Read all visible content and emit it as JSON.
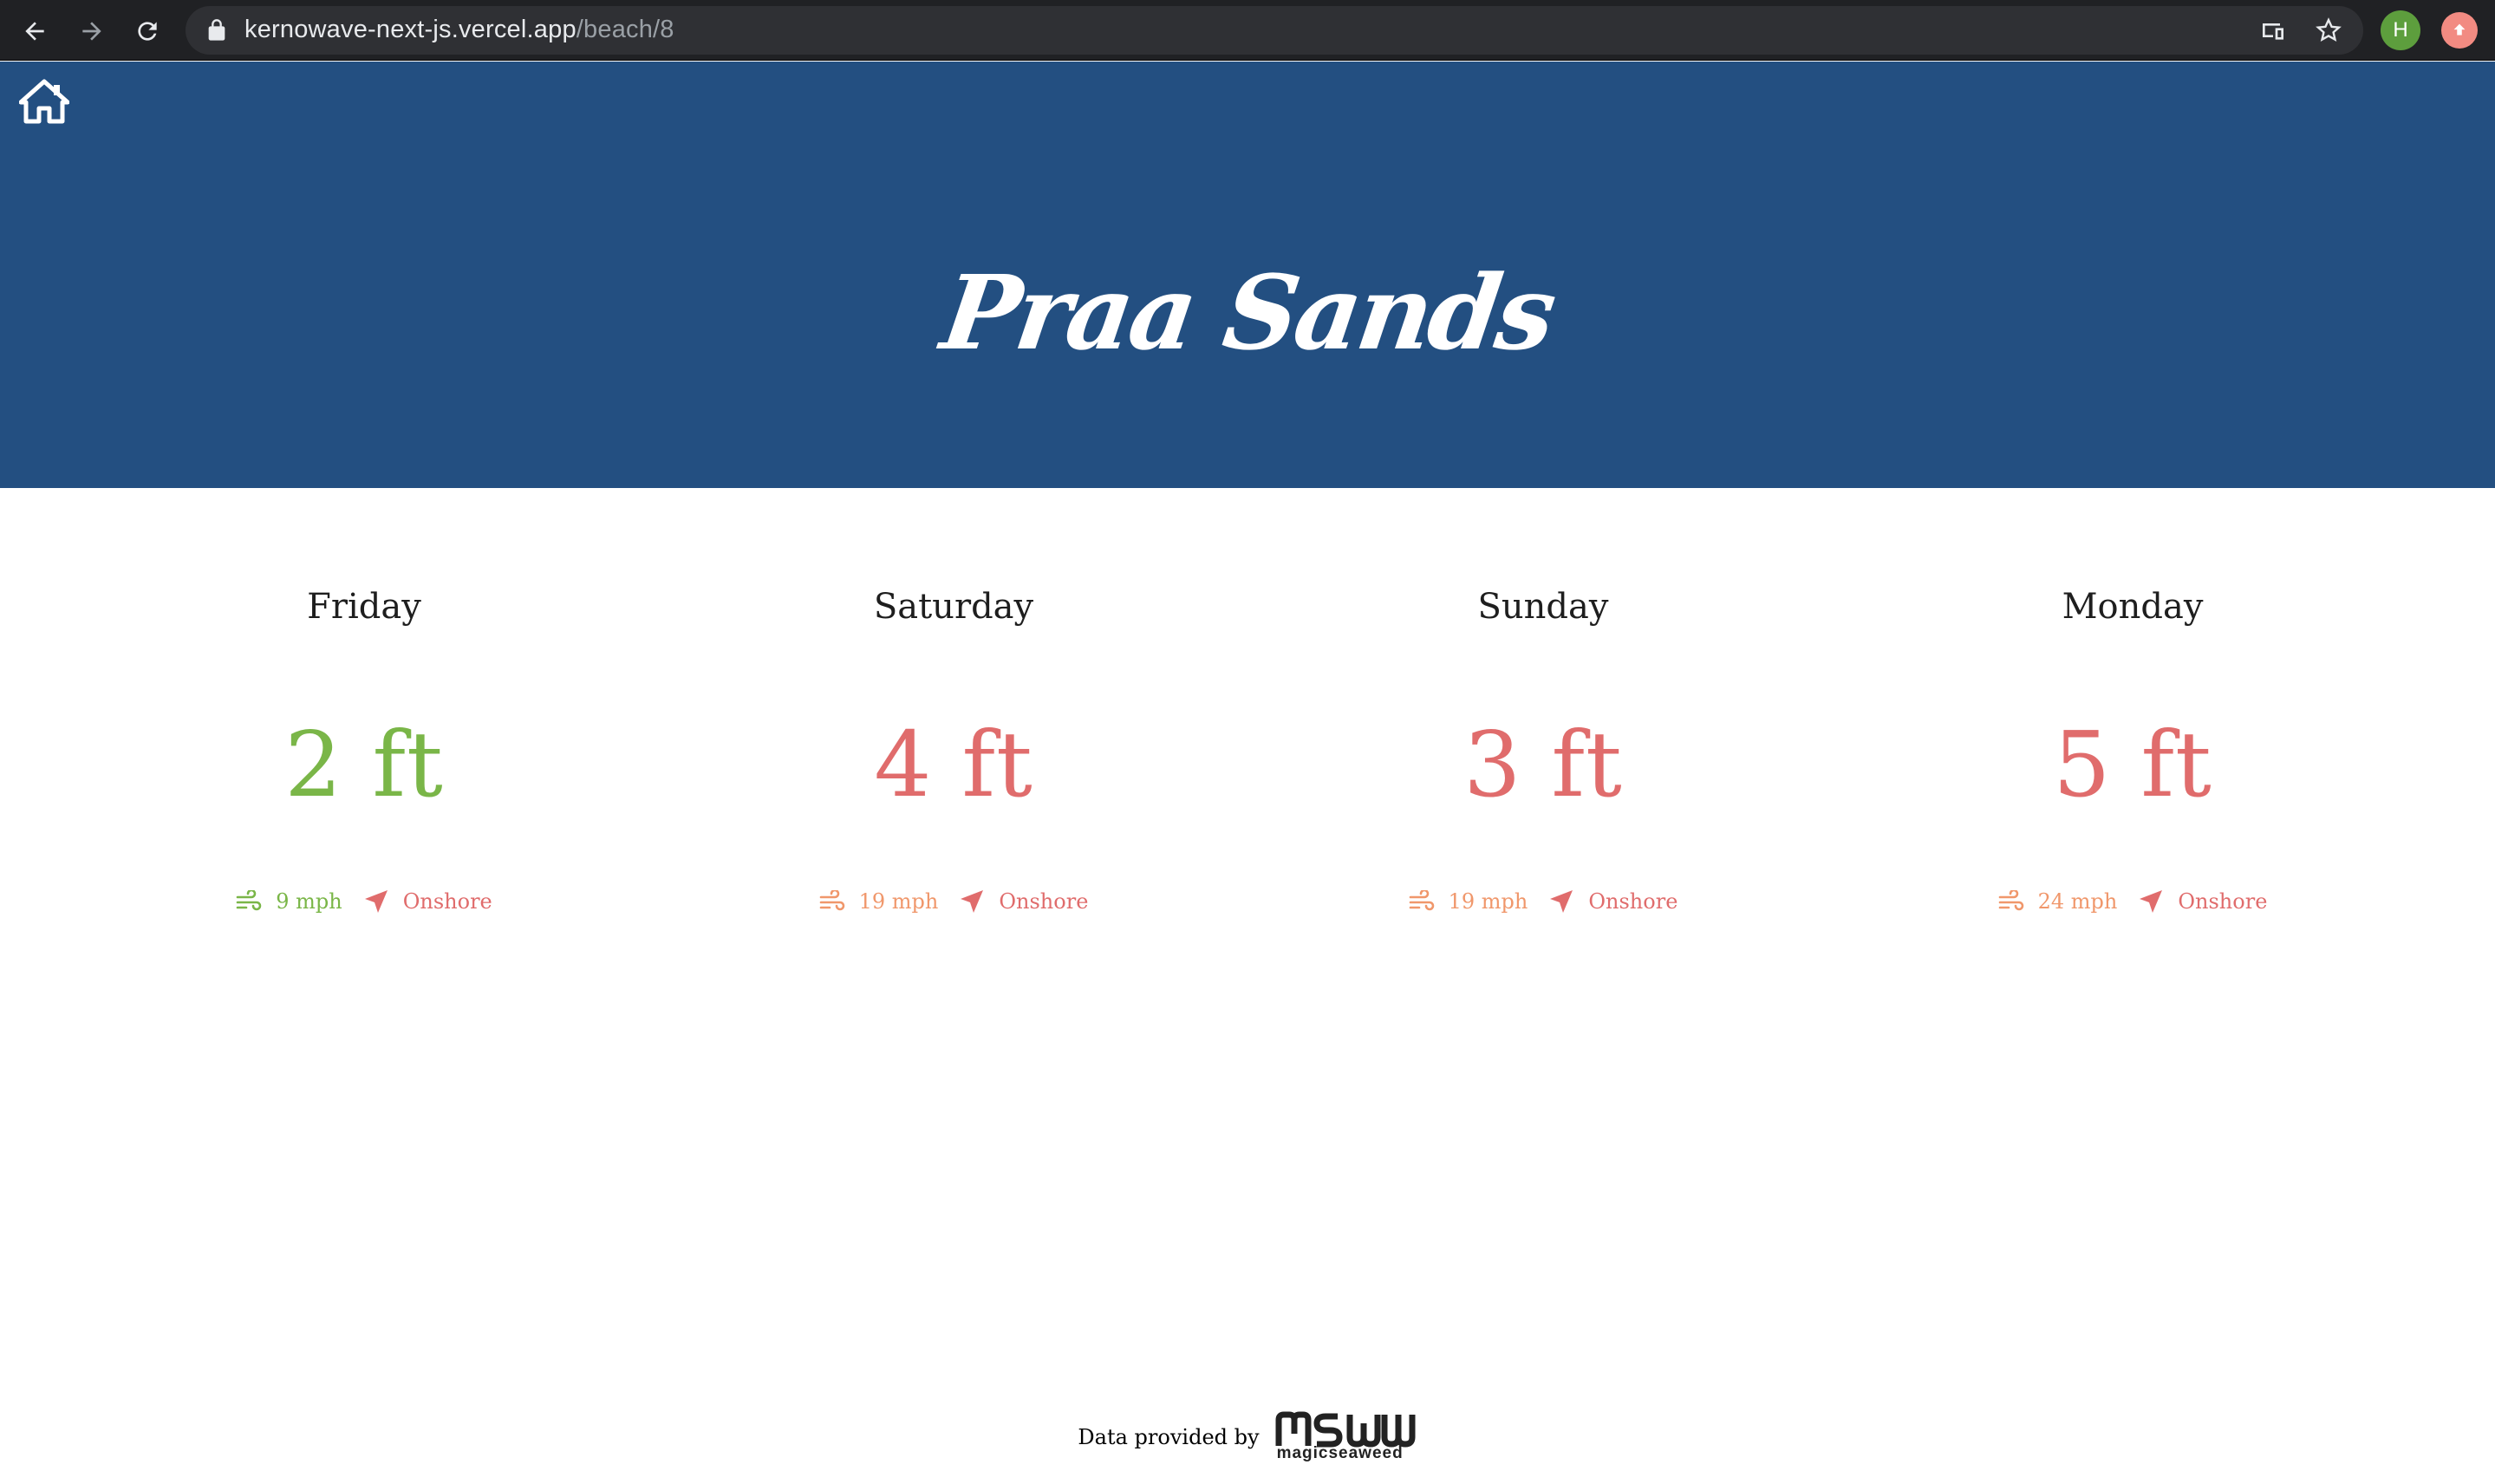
{
  "browser": {
    "url_host": "kernowave-next-js.vercel.app",
    "url_path": "/beach/8",
    "profile_initial": "H"
  },
  "beach": {
    "name": "Praa Sands"
  },
  "colors": {
    "header_bg": "#234f81",
    "good": "#7ab648",
    "bad": "#e06c6c",
    "moderate": "#f0976b"
  },
  "forecast": [
    {
      "day": "Friday",
      "wave": "2 ft",
      "wind_speed": "9 mph",
      "wind_dir": "Onshore",
      "wave_color": "#7ab648",
      "wind_color": "#7ab648",
      "dir_color": "#e06c6c"
    },
    {
      "day": "Saturday",
      "wave": "4 ft",
      "wind_speed": "19 mph",
      "wind_dir": "Onshore",
      "wave_color": "#e06c6c",
      "wind_color": "#f0976b",
      "dir_color": "#e06c6c"
    },
    {
      "day": "Sunday",
      "wave": "3 ft",
      "wind_speed": "19 mph",
      "wind_dir": "Onshore",
      "wave_color": "#e06c6c",
      "wind_color": "#f0976b",
      "dir_color": "#e06c6c"
    },
    {
      "day": "Monday",
      "wave": "5 ft",
      "wind_speed": "24 mph",
      "wind_dir": "Onshore",
      "wave_color": "#e06c6c",
      "wind_color": "#f0976b",
      "dir_color": "#e06c6c"
    }
  ],
  "footer": {
    "credit": "Data provided by",
    "logo_mark": "msw",
    "logo_word": "magicseaweed"
  }
}
